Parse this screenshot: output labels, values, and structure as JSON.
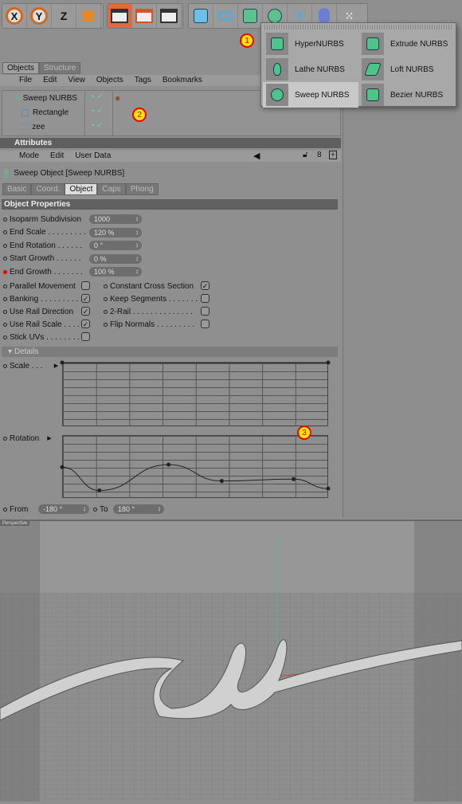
{
  "toolbar": {
    "axis": [
      "X",
      "Y",
      "Z"
    ]
  },
  "create_menu": {
    "items": [
      {
        "label": "HyperNURBS"
      },
      {
        "label": "Extrude NURBS"
      },
      {
        "label": "Lathe NURBS"
      },
      {
        "label": "Loft NURBS"
      },
      {
        "label": "Sweep NURBS",
        "highlighted": true
      },
      {
        "label": "Bezier NURBS"
      }
    ]
  },
  "annotations": [
    "1",
    "2",
    "3"
  ],
  "objects": {
    "tabs": [
      "Objects",
      "Structure"
    ],
    "menu": [
      "File",
      "Edit",
      "View",
      "Objects",
      "Tags",
      "Bookmarks"
    ],
    "tree": [
      {
        "name": "Sweep NURBS"
      },
      {
        "name": "Rectangle"
      },
      {
        "name": "zee"
      }
    ]
  },
  "attributes": {
    "title": "Attributes",
    "menu": [
      "Mode",
      "Edit",
      "User Data"
    ],
    "object_title": "Sweep Object [Sweep NURBS]",
    "tabs": [
      "Basic",
      "Coord.",
      "Object",
      "Caps",
      "Phong"
    ],
    "active_tab": "Object",
    "section": "Object Properties",
    "fields": [
      {
        "label": "Isoparm Subdivision",
        "value": "1000"
      },
      {
        "label": "End Scale . . . . . . . . .",
        "value": "120 %"
      },
      {
        "label": "End Rotation . . . . . .",
        "value": "0 °"
      },
      {
        "label": "Start Growth . . . . . .",
        "value": "0 %"
      },
      {
        "label": "End Growth . . . . . . .",
        "value": "100 %",
        "animated": true
      }
    ],
    "checks_left": [
      {
        "label": "Parallel Movement",
        "checked": false
      },
      {
        "label": "Banking . . . . . . . . . .",
        "checked": true
      },
      {
        "label": "Use Rail Direction",
        "checked": true
      },
      {
        "label": "Use Rail Scale . . . .",
        "checked": true
      },
      {
        "label": "Stick UVs . . . . . . . .",
        "checked": false
      }
    ],
    "checks_right": [
      {
        "label": "Constant Cross Section",
        "checked": true
      },
      {
        "label": "Keep Segments . . . . . . .",
        "checked": false
      },
      {
        "label": "2-Rail . . . . . . . . . . . . . .",
        "checked": false
      },
      {
        "label": "Flip Normals . . . . . . . . .",
        "checked": false
      }
    ],
    "details": "Details",
    "scale_label": "Scale . . .",
    "rotation_label": "Rotation",
    "scale_points": [
      [
        0,
        1
      ],
      [
        1,
        1
      ]
    ],
    "rotation_points": [
      [
        0,
        0.49
      ],
      [
        0.14,
        0.12
      ],
      [
        0.4,
        0.53
      ],
      [
        0.6,
        0.27
      ],
      [
        0.87,
        0.3
      ],
      [
        1,
        0.15
      ]
    ],
    "from_label": "From",
    "from_value": "-180 °",
    "to_label": "To",
    "to_value": "180 °"
  },
  "viewport": {
    "label": "Perspective"
  }
}
